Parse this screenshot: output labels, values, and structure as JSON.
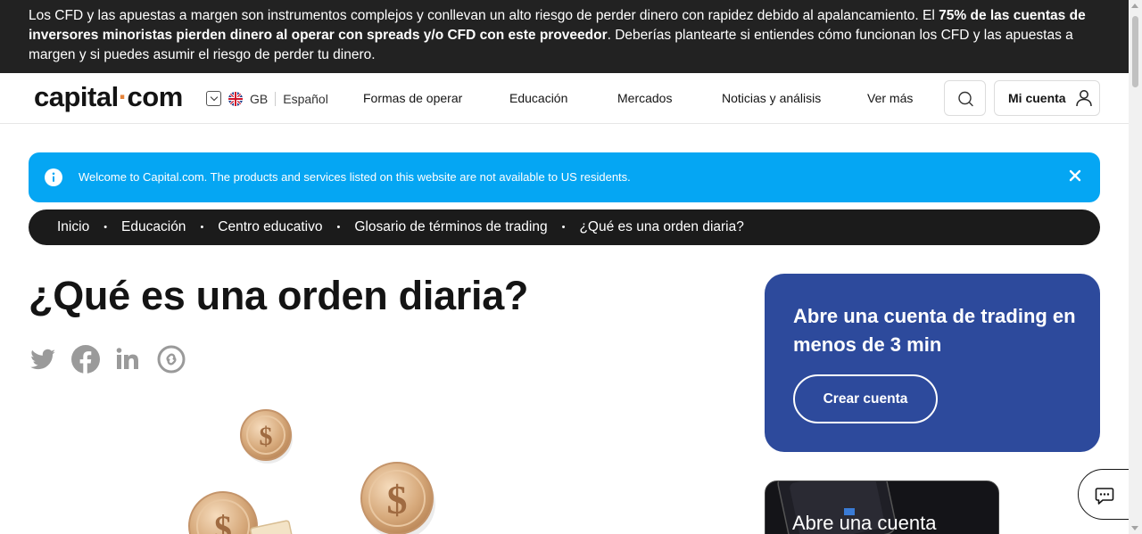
{
  "risk_warning": {
    "part1": "Los CFD y las apuestas a margen son instrumentos complejos y conllevan un alto riesgo de perder dinero con rapidez debido al apalancamiento. El ",
    "bold": "75% de las cuentas de inversores minoristas pierden dinero al operar con spreads y/o CFD con este proveedor",
    "part2": ". Deberías plantearte si entiendes cómo funcionan los CFD y las apuestas a margen y si puedes asumir el riesgo de perder tu dinero."
  },
  "header": {
    "logo_left": "capital",
    "logo_dot": "·",
    "logo_right": "com",
    "region": "GB",
    "language": "Español",
    "nav": [
      "Formas de operar",
      "Educación",
      "Mercados",
      "Noticias y análisis",
      "Ver más"
    ],
    "account_label": "Mi cuenta"
  },
  "notice": {
    "text": "Welcome to Capital.com. The products and services listed on this website are not available to US residents."
  },
  "breadcrumb": [
    "Inicio",
    "Educación",
    "Centro educativo",
    "Glosario de términos de trading",
    "¿Qué es una orden diaria?"
  ],
  "breadcrumb_separator": "•",
  "page": {
    "title": "¿Qué es una orden diaria?"
  },
  "share_icons": [
    "twitter-icon",
    "facebook-icon",
    "linkedin-icon",
    "copy-link-icon"
  ],
  "signup_card": {
    "heading": "Abre una cuenta de trading en menos de 3 min",
    "cta": "Crear cuenta"
  },
  "promo_card": {
    "text": "Abre una cuenta"
  },
  "colors": {
    "risk_bar_bg": "#222222",
    "notice_bg": "#05a6f3",
    "breadcrumb_bg": "#1b1b1b",
    "card_bg": "#2d4a9c",
    "brand_accent": "#e5833a"
  }
}
